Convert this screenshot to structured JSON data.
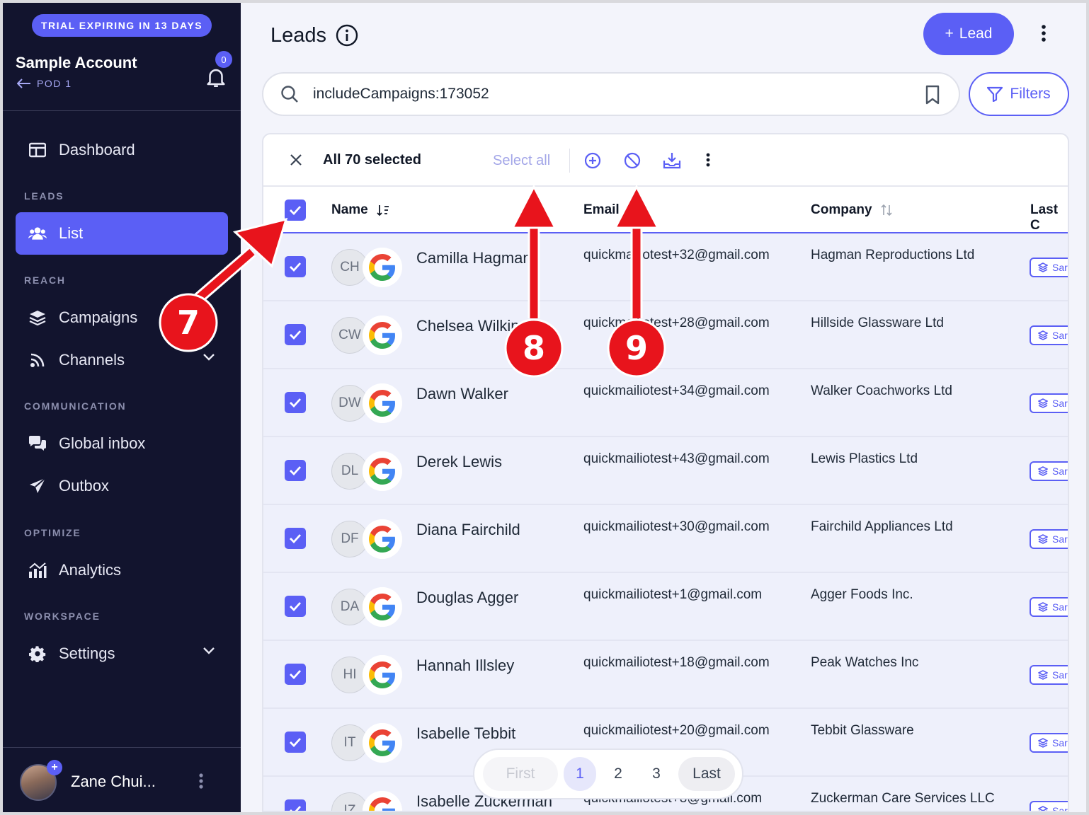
{
  "sidebar": {
    "trial_badge": "TRIAL EXPIRING IN 13 DAYS",
    "account_name": "Sample Account",
    "account_pod": "POD 1",
    "notification_count": "0",
    "dashboard_label": "Dashboard",
    "sections": {
      "leads": "LEADS",
      "reach": "REACH",
      "communication": "COMMUNICATION",
      "optimize": "OPTIMIZE",
      "workspace": "WORKSPACE"
    },
    "items": {
      "list": "List",
      "campaigns": "Campaigns",
      "channels": "Channels",
      "global_inbox": "Global inbox",
      "outbox": "Outbox",
      "analytics": "Analytics",
      "settings": "Settings"
    },
    "user_name": "Zane Chui...",
    "user_plus": "+"
  },
  "header": {
    "title": "Leads",
    "lead_button": "Lead",
    "lead_button_plus": "+"
  },
  "search": {
    "value": "includeCampaigns:173052",
    "filters_label": "Filters"
  },
  "toolbar": {
    "selected_text": "All 70 selected",
    "select_all": "Select all"
  },
  "table": {
    "columns": [
      "Name",
      "Email",
      "Company",
      "Last C"
    ],
    "rows": [
      {
        "initials": "CH",
        "name": "Camilla Hagman",
        "email": "quickmailiotest+32@gmail.com",
        "company": "Hagman Reproductions Ltd",
        "chip": "Sar"
      },
      {
        "initials": "CW",
        "name": "Chelsea Wilkins",
        "email": "quickmailiotest+28@gmail.com",
        "company": "Hillside Glassware Ltd",
        "chip": "Sar"
      },
      {
        "initials": "DW",
        "name": "Dawn Walker",
        "email": "quickmailiotest+34@gmail.com",
        "company": "Walker Coachworks Ltd",
        "chip": "Sar"
      },
      {
        "initials": "DL",
        "name": "Derek Lewis",
        "email": "quickmailiotest+43@gmail.com",
        "company": "Lewis Plastics Ltd",
        "chip": "Sar"
      },
      {
        "initials": "DF",
        "name": "Diana Fairchild",
        "email": "quickmailiotest+30@gmail.com",
        "company": "Fairchild Appliances Ltd",
        "chip": "Sar"
      },
      {
        "initials": "DA",
        "name": "Douglas Agger",
        "email": "quickmailiotest+1@gmail.com",
        "company": "Agger Foods Inc.",
        "chip": "Sar"
      },
      {
        "initials": "HI",
        "name": "Hannah Illsley",
        "email": "quickmailiotest+18@gmail.com",
        "company": "Peak Watches Inc",
        "chip": "Sar"
      },
      {
        "initials": "IT",
        "name": "Isabelle Tebbit",
        "email": "quickmailiotest+20@gmail.com",
        "company": "Tebbit Glassware",
        "chip": "Sar"
      },
      {
        "initials": "IZ",
        "name": "Isabelle Zuckerman",
        "email": "quickmailiotest+8@gmail.com",
        "company": "Zuckerman Care Services LLC",
        "chip": "Sar"
      }
    ]
  },
  "pagination": {
    "first": "First",
    "pages": [
      "1",
      "2",
      "3"
    ],
    "last": "Last",
    "current": "1"
  },
  "annotations": {
    "marker_7": "7",
    "marker_8": "8",
    "marker_9": "9"
  },
  "colors": {
    "accent": "#5b5ff5",
    "sidebar_bg": "#12142e",
    "annotation_red": "#e8141c"
  },
  "icons": [
    "sidebar-toggle-icon",
    "bell-icon",
    "users-icon",
    "layers-icon",
    "rss-icon",
    "chat-icon",
    "send-icon",
    "analytics-icon",
    "gear-icon",
    "info-icon",
    "search-icon",
    "bookmark-icon",
    "filter-icon",
    "close-icon",
    "add-circle-icon",
    "block-icon",
    "download-icon",
    "more-icon",
    "google-icon"
  ]
}
